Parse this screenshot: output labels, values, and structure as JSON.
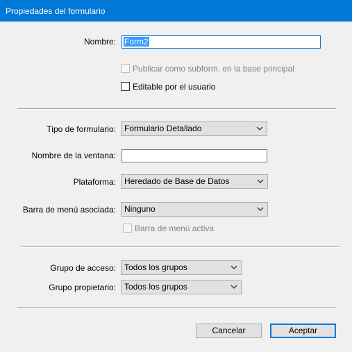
{
  "window": {
    "title": "Propiedades del formulario"
  },
  "name_row": {
    "label": "Nombre:",
    "value": "Form2"
  },
  "checkboxes": {
    "publish": {
      "label": "Publicar como subform. en la base principal",
      "checked": false,
      "enabled": false
    },
    "editable": {
      "label": "Editable por el usuario",
      "checked": false,
      "enabled": true
    },
    "menu_active": {
      "label": "Barra de menú activa",
      "checked": false,
      "enabled": false
    }
  },
  "form_type": {
    "label": "Tipo de formulario:",
    "value": "Formulario Detallado"
  },
  "window_name": {
    "label": "Nombre de la ventana:",
    "value": ""
  },
  "platform": {
    "label": "Plataforma:",
    "value": "Heredado de Base de Datos"
  },
  "menu_bar": {
    "label": "Barra de menú asociada:",
    "value": "Ninguno"
  },
  "access_group": {
    "label": "Grupo de acceso:",
    "value": "Todos los grupos"
  },
  "owner_group": {
    "label": "Grupo propietario:",
    "value": "Todos los grupos"
  },
  "buttons": {
    "cancel": "Cancelar",
    "accept": "Aceptar"
  },
  "colors": {
    "titlebar": "#0078d7",
    "background": "#f0f0f0",
    "selection": "#3399ff"
  },
  "icons": {
    "dropdown": "chevron-down-icon"
  }
}
